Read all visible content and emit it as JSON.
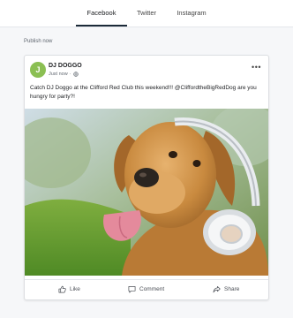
{
  "tabs": [
    {
      "label": "Facebook",
      "active": true
    },
    {
      "label": "Twitter",
      "active": false
    },
    {
      "label": "Instagram",
      "active": false
    }
  ],
  "publish_label": "Publish now",
  "post": {
    "avatar_initial": "J",
    "page_name": "DJ DOGGO",
    "timestamp": "Just now",
    "privacy_icon": "globe-icon",
    "text": "Catch DJ Doggo at the Clifford Red Club this weekend!!! @CliffordtheBigRedDog are you hungry for party?!",
    "image_subject": "dog-with-headphones",
    "actions": {
      "like": "Like",
      "comment": "Comment",
      "share": "Share"
    }
  },
  "colors": {
    "avatar": "#8bbf53",
    "active_tab_underline": "#1b2a38",
    "page_background": "#f6f7f9"
  }
}
